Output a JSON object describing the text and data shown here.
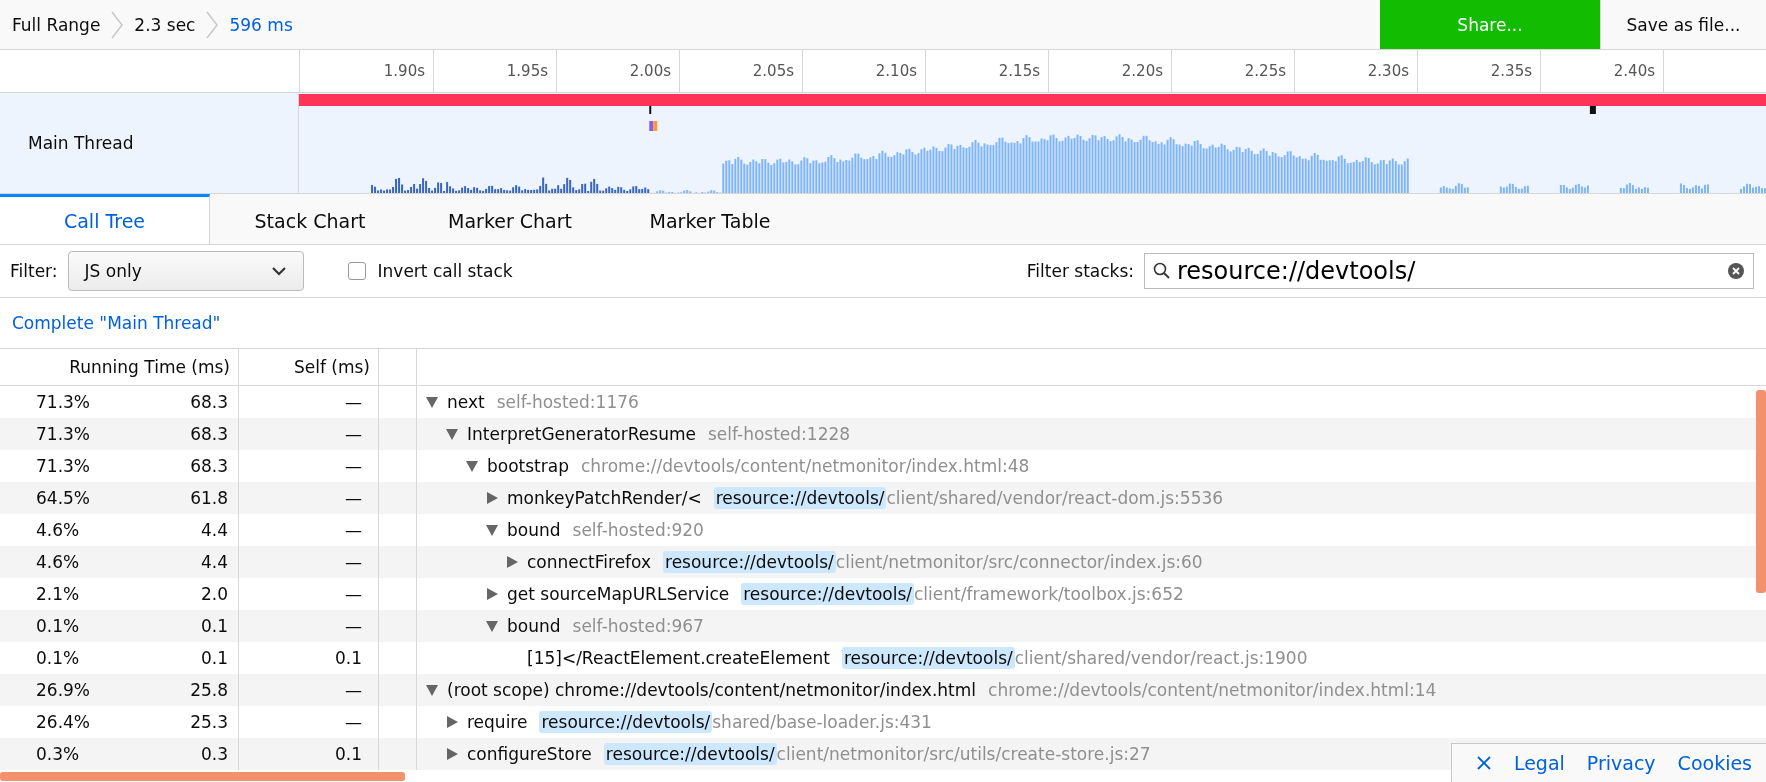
{
  "breadcrumbs": [
    {
      "label": "Full Range",
      "selected": false
    },
    {
      "label": "2.3 sec",
      "selected": false
    },
    {
      "label": "596 ms",
      "selected": true
    }
  ],
  "buttons": {
    "share": "Share...",
    "save": "Save as file..."
  },
  "timeline": {
    "ticks": [
      "1.90s",
      "1.95s",
      "2.00s",
      "2.05s",
      "2.10s",
      "2.15s",
      "2.20s",
      "2.25s",
      "2.30s",
      "2.35s",
      "2.40s"
    ],
    "track": {
      "label": "Main Thread"
    }
  },
  "tabs": [
    {
      "label": "Call Tree",
      "selected": true
    },
    {
      "label": "Stack Chart",
      "selected": false
    },
    {
      "label": "Marker Chart",
      "selected": false
    },
    {
      "label": "Marker Table",
      "selected": false
    }
  ],
  "filter": {
    "label": "Filter:",
    "value": "JS only",
    "invert": {
      "label": "Invert call stack",
      "checked": false
    },
    "search_label": "Filter stacks:",
    "search_value": "resource://devtools/"
  },
  "thread_breadcrumb": "Complete \"Main Thread\"",
  "columns": [
    "Running Time (ms)",
    "Self (ms)"
  ],
  "tree": [
    {
      "percent": "71.3%",
      "running": "68.3",
      "self": "—",
      "name": "next",
      "origin": [
        {
          "text": "self-hosted:1176",
          "match": false
        }
      ],
      "kind": "branch",
      "expanded": true,
      "children": [
        {
          "percent": "71.3%",
          "running": "68.3",
          "self": "—",
          "name": "InterpretGeneratorResume",
          "origin": [
            {
              "text": "self-hosted:1228",
              "match": false
            }
          ],
          "kind": "branch",
          "expanded": true,
          "children": [
            {
              "percent": "71.3%",
              "running": "68.3",
              "self": "—",
              "name": "bootstrap",
              "origin": [
                {
                  "text": "chrome://devtools/content/netmonitor/index.html:48",
                  "match": false
                }
              ],
              "kind": "branch",
              "expanded": true,
              "children": [
                {
                  "percent": "64.5%",
                  "running": "61.8",
                  "self": "—",
                  "name": "monkeyPatchRender/<",
                  "origin": [
                    {
                      "text": "resource://devtools/",
                      "match": true
                    },
                    {
                      "text": "client/shared/vendor/react-dom.js:5536",
                      "match": false
                    }
                  ],
                  "kind": "branch",
                  "expanded": false
                },
                {
                  "percent": "4.6%",
                  "running": "4.4",
                  "self": "—",
                  "name": "bound",
                  "origin": [
                    {
                      "text": "self-hosted:920",
                      "match": false
                    }
                  ],
                  "kind": "branch",
                  "expanded": true,
                  "children": [
                    {
                      "percent": "4.6%",
                      "running": "4.4",
                      "self": "—",
                      "name": "connectFirefox",
                      "origin": [
                        {
                          "text": "resource://devtools/",
                          "match": true
                        },
                        {
                          "text": "client/netmonitor/src/connector/index.js:60",
                          "match": false
                        }
                      ],
                      "kind": "branch",
                      "expanded": false
                    }
                  ]
                },
                {
                  "percent": "2.1%",
                  "running": "2.0",
                  "self": "—",
                  "name": "get sourceMapURLService",
                  "origin": [
                    {
                      "text": "resource://devtools/",
                      "match": true
                    },
                    {
                      "text": "client/framework/toolbox.js:652",
                      "match": false
                    }
                  ],
                  "kind": "branch",
                  "expanded": false
                },
                {
                  "percent": "0.1%",
                  "running": "0.1",
                  "self": "—",
                  "name": "bound",
                  "origin": [
                    {
                      "text": "self-hosted:967",
                      "match": false
                    }
                  ],
                  "kind": "branch",
                  "expanded": true,
                  "children": [
                    {
                      "percent": "0.1%",
                      "running": "0.1",
                      "self": "0.1",
                      "name": "[15]</ReactElement.createElement",
                      "origin": [
                        {
                          "text": "resource://devtools/",
                          "match": true
                        },
                        {
                          "text": "client/shared/vendor/react.js:1900",
                          "match": false
                        }
                      ],
                      "kind": "leaf"
                    }
                  ]
                }
              ]
            }
          ]
        }
      ]
    },
    {
      "percent": "26.9%",
      "running": "25.8",
      "self": "—",
      "name": "(root scope) chrome://devtools/content/netmonitor/index.html",
      "origin": [
        {
          "text": "chrome://devtools/content/netmonitor/index.html:14",
          "match": false
        }
      ],
      "kind": "branch",
      "expanded": true,
      "children": [
        {
          "percent": "26.4%",
          "running": "25.3",
          "self": "—",
          "name": "require",
          "origin": [
            {
              "text": "resource://devtools/",
              "match": true
            },
            {
              "text": "shared/base-loader.js:431",
              "match": false
            }
          ],
          "kind": "branch",
          "expanded": false
        },
        {
          "percent": "0.3%",
          "running": "0.3",
          "self": "0.1",
          "name": "configureStore",
          "origin": [
            {
              "text": "resource://devtools/",
              "match": true
            },
            {
              "text": "client/netmonitor/src/utils/create-store.js:27",
              "match": false
            }
          ],
          "kind": "branch",
          "expanded": false
        }
      ]
    }
  ],
  "footer_links": [
    "Legal",
    "Privacy",
    "Cookies"
  ]
}
